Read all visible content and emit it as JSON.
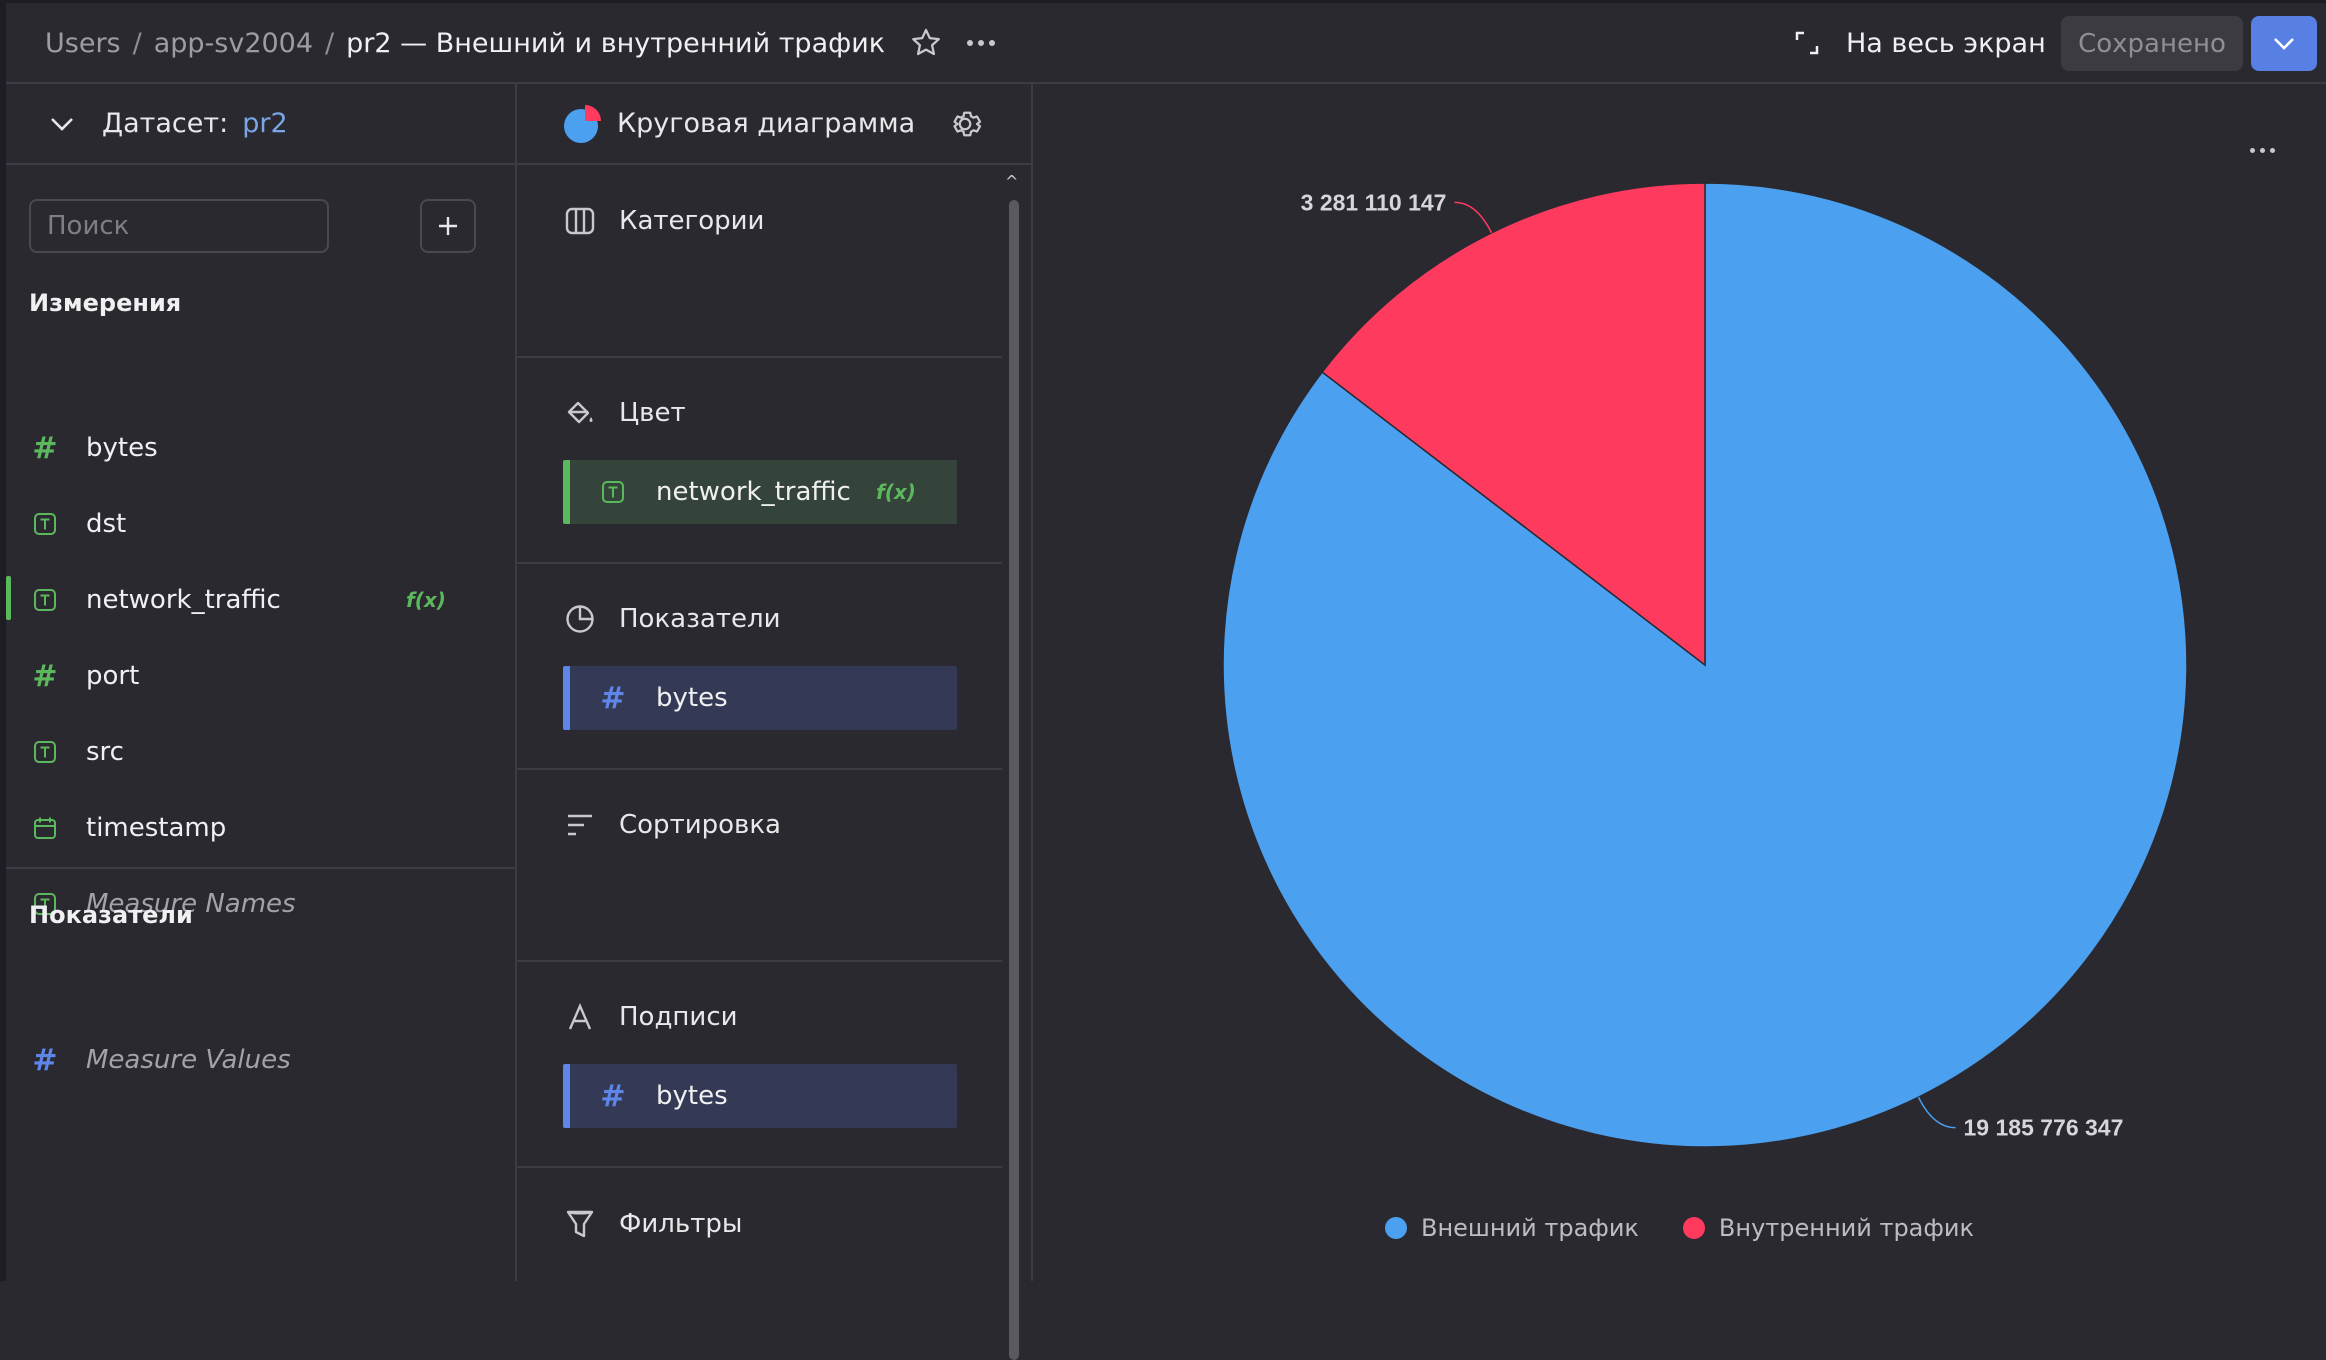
{
  "header": {
    "breadcrumbs": [
      "Users",
      "app-sv2004",
      "pr2 — Внешний и внутренний трафик"
    ],
    "separator": "/",
    "fullscreen_label": "На весь экран",
    "saved_label": "Сохранено"
  },
  "dataset": {
    "label": "Датасет:",
    "name": "pr2",
    "search_placeholder": "Поиск",
    "dimensions_title": "Измерения",
    "dimensions": [
      {
        "name": "bytes",
        "type": "number"
      },
      {
        "name": "dst",
        "type": "text"
      },
      {
        "name": "network_traffic",
        "type": "text",
        "badge": "f(x)",
        "selected": true
      },
      {
        "name": "port",
        "type": "number"
      },
      {
        "name": "src",
        "type": "text"
      },
      {
        "name": "timestamp",
        "type": "date"
      },
      {
        "name": "Measure Names",
        "type": "text",
        "italic": true
      }
    ],
    "measures_title": "Показатели",
    "measures": [
      {
        "name": "Measure Values",
        "type": "number",
        "italic": true
      }
    ]
  },
  "visualization": {
    "type_label": "Круговая диаграмма",
    "sections": {
      "categories": "Категории",
      "color": "Цвет",
      "measures": "Показатели",
      "sort": "Сортировка",
      "labels": "Подписи",
      "filters": "Фильтры"
    },
    "color_field": {
      "name": "network_traffic",
      "badge": "f(x)"
    },
    "measure_field": {
      "name": "bytes"
    },
    "label_field": {
      "name": "bytes"
    }
  },
  "chart_data": {
    "type": "pie",
    "series": [
      {
        "name": "Внешний трафик",
        "value": 19185776347,
        "label": "19 185 776 347",
        "color": "#4ba0ef"
      },
      {
        "name": "Внутренний трафик",
        "value": 3281110147,
        "label": "3 281 110 147",
        "color": "#ff3a5f"
      }
    ],
    "legend_position": "bottom"
  }
}
